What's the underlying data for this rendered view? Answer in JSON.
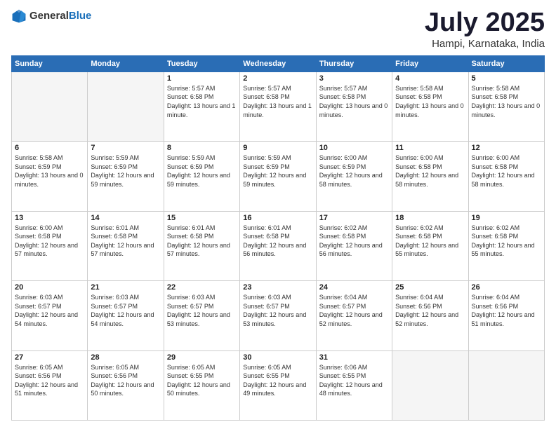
{
  "logo": {
    "general": "General",
    "blue": "Blue"
  },
  "header": {
    "month": "July 2025",
    "location": "Hampi, Karnataka, India"
  },
  "weekdays": [
    "Sunday",
    "Monday",
    "Tuesday",
    "Wednesday",
    "Thursday",
    "Friday",
    "Saturday"
  ],
  "weeks": [
    [
      {
        "day": "",
        "info": ""
      },
      {
        "day": "",
        "info": ""
      },
      {
        "day": "1",
        "info": "Sunrise: 5:57 AM\nSunset: 6:58 PM\nDaylight: 13 hours and 1 minute."
      },
      {
        "day": "2",
        "info": "Sunrise: 5:57 AM\nSunset: 6:58 PM\nDaylight: 13 hours and 1 minute."
      },
      {
        "day": "3",
        "info": "Sunrise: 5:57 AM\nSunset: 6:58 PM\nDaylight: 13 hours and 0 minutes."
      },
      {
        "day": "4",
        "info": "Sunrise: 5:58 AM\nSunset: 6:58 PM\nDaylight: 13 hours and 0 minutes."
      },
      {
        "day": "5",
        "info": "Sunrise: 5:58 AM\nSunset: 6:58 PM\nDaylight: 13 hours and 0 minutes."
      }
    ],
    [
      {
        "day": "6",
        "info": "Sunrise: 5:58 AM\nSunset: 6:59 PM\nDaylight: 13 hours and 0 minutes."
      },
      {
        "day": "7",
        "info": "Sunrise: 5:59 AM\nSunset: 6:59 PM\nDaylight: 12 hours and 59 minutes."
      },
      {
        "day": "8",
        "info": "Sunrise: 5:59 AM\nSunset: 6:59 PM\nDaylight: 12 hours and 59 minutes."
      },
      {
        "day": "9",
        "info": "Sunrise: 5:59 AM\nSunset: 6:59 PM\nDaylight: 12 hours and 59 minutes."
      },
      {
        "day": "10",
        "info": "Sunrise: 6:00 AM\nSunset: 6:59 PM\nDaylight: 12 hours and 58 minutes."
      },
      {
        "day": "11",
        "info": "Sunrise: 6:00 AM\nSunset: 6:58 PM\nDaylight: 12 hours and 58 minutes."
      },
      {
        "day": "12",
        "info": "Sunrise: 6:00 AM\nSunset: 6:58 PM\nDaylight: 12 hours and 58 minutes."
      }
    ],
    [
      {
        "day": "13",
        "info": "Sunrise: 6:00 AM\nSunset: 6:58 PM\nDaylight: 12 hours and 57 minutes."
      },
      {
        "day": "14",
        "info": "Sunrise: 6:01 AM\nSunset: 6:58 PM\nDaylight: 12 hours and 57 minutes."
      },
      {
        "day": "15",
        "info": "Sunrise: 6:01 AM\nSunset: 6:58 PM\nDaylight: 12 hours and 57 minutes."
      },
      {
        "day": "16",
        "info": "Sunrise: 6:01 AM\nSunset: 6:58 PM\nDaylight: 12 hours and 56 minutes."
      },
      {
        "day": "17",
        "info": "Sunrise: 6:02 AM\nSunset: 6:58 PM\nDaylight: 12 hours and 56 minutes."
      },
      {
        "day": "18",
        "info": "Sunrise: 6:02 AM\nSunset: 6:58 PM\nDaylight: 12 hours and 55 minutes."
      },
      {
        "day": "19",
        "info": "Sunrise: 6:02 AM\nSunset: 6:58 PM\nDaylight: 12 hours and 55 minutes."
      }
    ],
    [
      {
        "day": "20",
        "info": "Sunrise: 6:03 AM\nSunset: 6:57 PM\nDaylight: 12 hours and 54 minutes."
      },
      {
        "day": "21",
        "info": "Sunrise: 6:03 AM\nSunset: 6:57 PM\nDaylight: 12 hours and 54 minutes."
      },
      {
        "day": "22",
        "info": "Sunrise: 6:03 AM\nSunset: 6:57 PM\nDaylight: 12 hours and 53 minutes."
      },
      {
        "day": "23",
        "info": "Sunrise: 6:03 AM\nSunset: 6:57 PM\nDaylight: 12 hours and 53 minutes."
      },
      {
        "day": "24",
        "info": "Sunrise: 6:04 AM\nSunset: 6:57 PM\nDaylight: 12 hours and 52 minutes."
      },
      {
        "day": "25",
        "info": "Sunrise: 6:04 AM\nSunset: 6:56 PM\nDaylight: 12 hours and 52 minutes."
      },
      {
        "day": "26",
        "info": "Sunrise: 6:04 AM\nSunset: 6:56 PM\nDaylight: 12 hours and 51 minutes."
      }
    ],
    [
      {
        "day": "27",
        "info": "Sunrise: 6:05 AM\nSunset: 6:56 PM\nDaylight: 12 hours and 51 minutes."
      },
      {
        "day": "28",
        "info": "Sunrise: 6:05 AM\nSunset: 6:56 PM\nDaylight: 12 hours and 50 minutes."
      },
      {
        "day": "29",
        "info": "Sunrise: 6:05 AM\nSunset: 6:55 PM\nDaylight: 12 hours and 50 minutes."
      },
      {
        "day": "30",
        "info": "Sunrise: 6:05 AM\nSunset: 6:55 PM\nDaylight: 12 hours and 49 minutes."
      },
      {
        "day": "31",
        "info": "Sunrise: 6:06 AM\nSunset: 6:55 PM\nDaylight: 12 hours and 48 minutes."
      },
      {
        "day": "",
        "info": ""
      },
      {
        "day": "",
        "info": ""
      }
    ]
  ]
}
